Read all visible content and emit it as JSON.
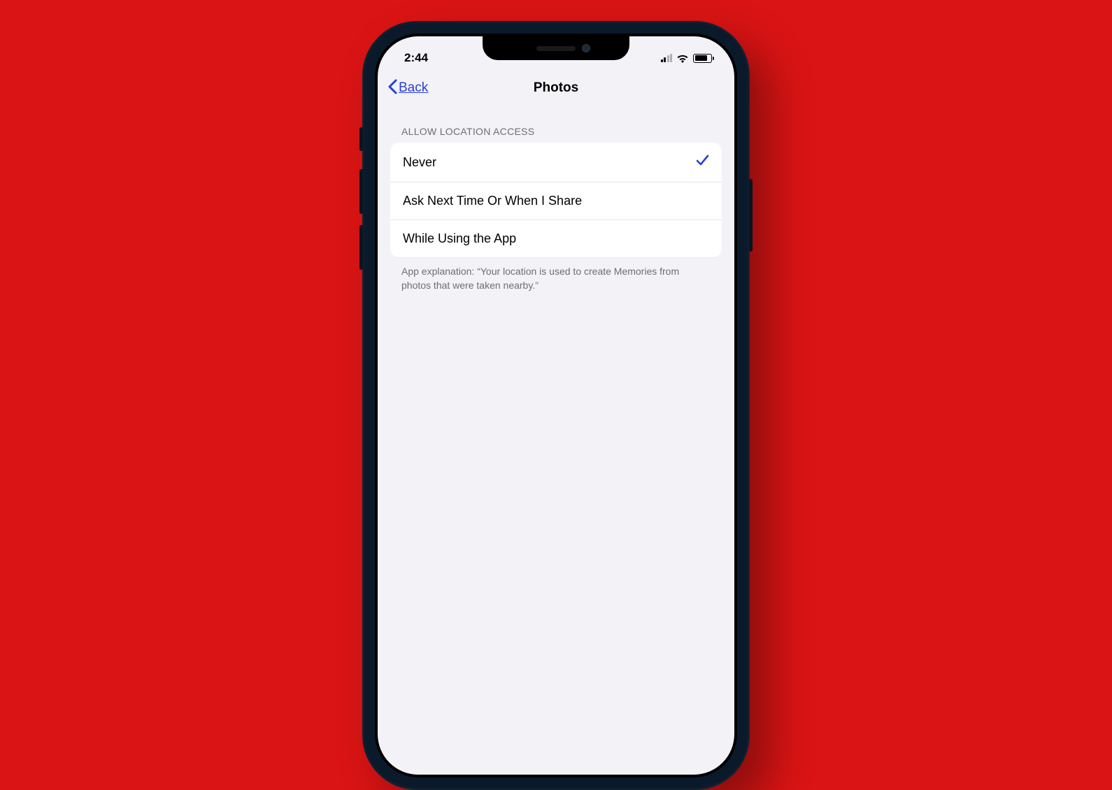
{
  "status": {
    "time": "2:44"
  },
  "nav": {
    "back_label": "Back",
    "title": "Photos"
  },
  "section": {
    "header": "ALLOW LOCATION ACCESS",
    "options": [
      {
        "label": "Never",
        "selected": true
      },
      {
        "label": "Ask Next Time Or When I Share",
        "selected": false
      },
      {
        "label": "While Using the App",
        "selected": false
      }
    ],
    "footer": "App explanation: “Your location is used to create Memories from photos that were taken nearby.”"
  }
}
